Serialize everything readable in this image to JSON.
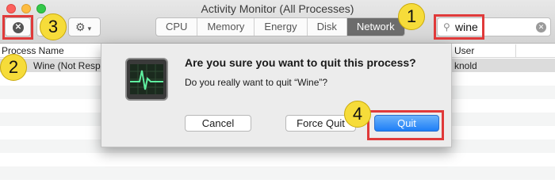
{
  "window": {
    "title": "Activity Monitor (All Processes)"
  },
  "toolbar": {
    "stop_glyph": "✕",
    "tabs": [
      "CPU",
      "Memory",
      "Energy",
      "Disk",
      "Network"
    ],
    "active_tab": "Network",
    "search": {
      "value": "wine"
    }
  },
  "table": {
    "headers": {
      "process": "Process Name",
      "user": "User"
    },
    "rows": [
      {
        "process": "Wine (Not Responding)",
        "user": "knold"
      }
    ]
  },
  "dialog": {
    "title": "Are you sure you want to quit this process?",
    "message": "Do you really want to quit “Wine”?",
    "buttons": {
      "cancel": "Cancel",
      "force_quit": "Force Quit",
      "quit": "Quit"
    }
  },
  "callouts": [
    "1",
    "2",
    "3",
    "4"
  ],
  "colors": {
    "callout_fill": "#f6dc3a",
    "highlight_box": "#e03a3a",
    "default_button": "#1d7ef7"
  },
  "icons": {
    "search": "magnifier-icon",
    "clear": "clear-search-icon",
    "gear": "gear-icon",
    "stop": "stop-process-icon"
  }
}
